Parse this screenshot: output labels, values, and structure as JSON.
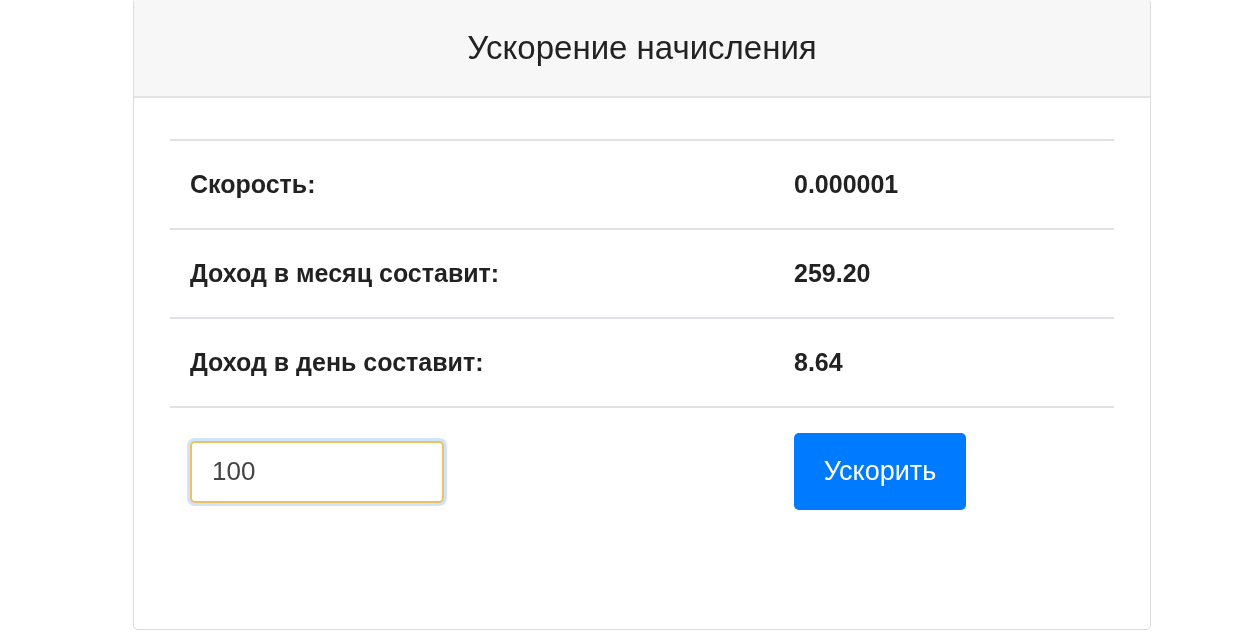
{
  "card": {
    "title": "Ускорение начисления"
  },
  "rows": [
    {
      "label": "Скорость:",
      "value": "0.000001"
    },
    {
      "label": "Доход в месяц составит:",
      "value": "259.20"
    },
    {
      "label": "Доход в день составит:",
      "value": "8.64"
    }
  ],
  "amount_field": {
    "value": "100"
  },
  "buttons": [
    "Ускорить"
  ]
}
